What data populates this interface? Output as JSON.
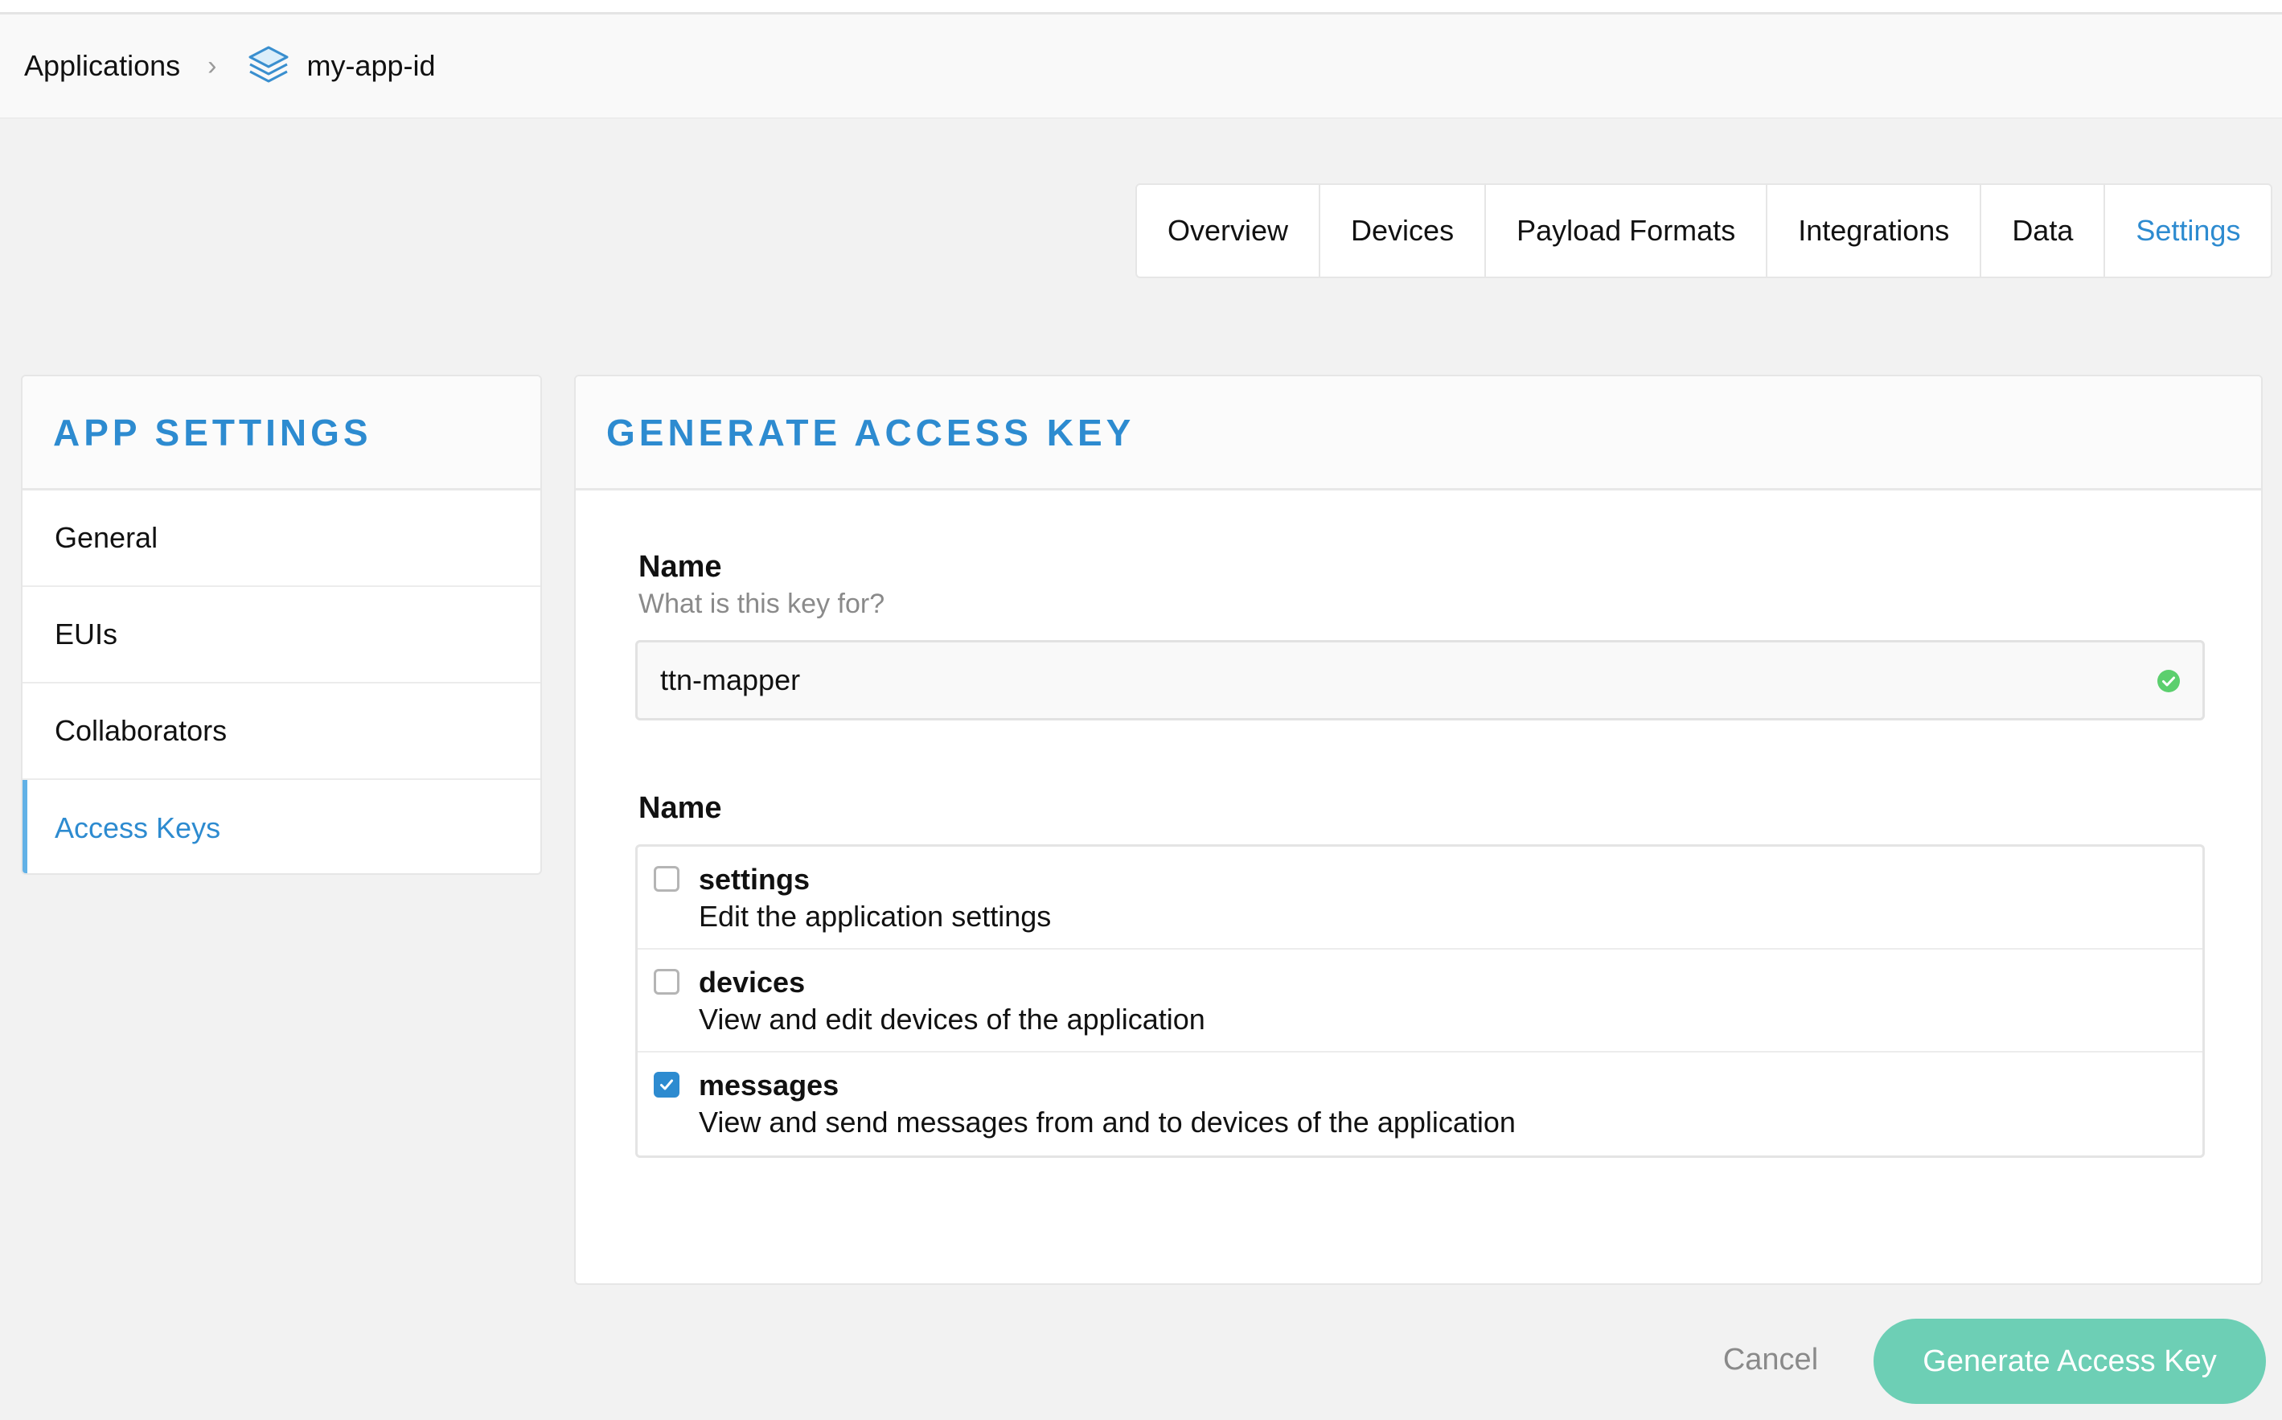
{
  "breadcrumb": {
    "root_label": "Applications",
    "separator": "›",
    "app_id": "my-app-id"
  },
  "tabs": [
    {
      "label": "Overview",
      "active": false
    },
    {
      "label": "Devices",
      "active": false
    },
    {
      "label": "Payload Formats",
      "active": false
    },
    {
      "label": "Integrations",
      "active": false
    },
    {
      "label": "Data",
      "active": false
    },
    {
      "label": "Settings",
      "active": true
    }
  ],
  "sidebar": {
    "title": "APP SETTINGS",
    "items": [
      {
        "label": "General",
        "active": false
      },
      {
        "label": "EUIs",
        "active": false
      },
      {
        "label": "Collaborators",
        "active": false
      },
      {
        "label": "Access Keys",
        "active": true
      }
    ]
  },
  "form": {
    "title": "GENERATE ACCESS KEY",
    "name_label": "Name",
    "name_help": "What is this key for?",
    "name_value": "ttn-mapper",
    "name_valid": true,
    "rights_label": "Name",
    "rights": [
      {
        "name": "settings",
        "description": "Edit the application settings",
        "checked": false
      },
      {
        "name": "devices",
        "description": "View and edit devices of the application",
        "checked": false
      },
      {
        "name": "messages",
        "description": "View and send messages from and to devices of the application",
        "checked": true
      }
    ]
  },
  "actions": {
    "cancel_label": "Cancel",
    "submit_label": "Generate Access Key"
  },
  "colors": {
    "accent": "#2d8bd0",
    "submit": "#6dcfb5",
    "valid": "#5ccf6e"
  },
  "icons": {
    "app": "layers-icon",
    "valid": "check-circle-icon",
    "checkbox_checked": "checkmark-icon"
  }
}
